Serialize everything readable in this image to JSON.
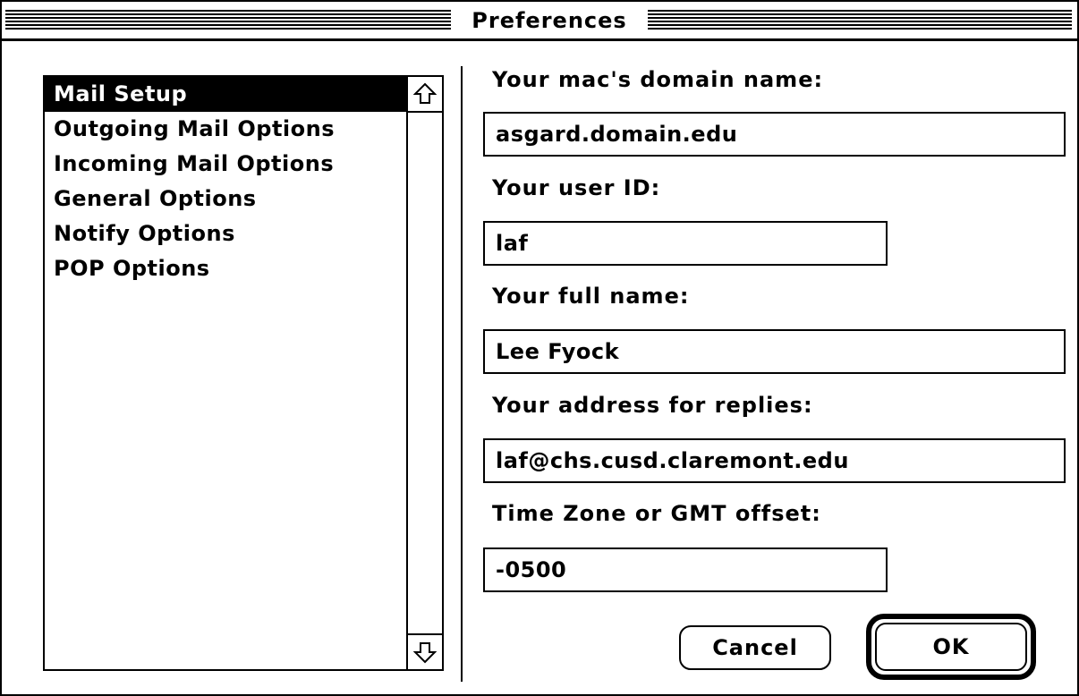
{
  "window": {
    "title": "Preferences"
  },
  "sidebar": {
    "items": [
      {
        "label": "Mail Setup",
        "selected": true
      },
      {
        "label": "Outgoing Mail Options",
        "selected": false
      },
      {
        "label": "Incoming Mail Options",
        "selected": false
      },
      {
        "label": "General Options",
        "selected": false
      },
      {
        "label": "Notify Options",
        "selected": false
      },
      {
        "label": "POP Options",
        "selected": false
      }
    ],
    "scroll_up_icon": "arrow-up-outline-icon",
    "scroll_down_icon": "arrow-down-outline-icon"
  },
  "form": {
    "domain": {
      "label": "Your mac's domain name:",
      "value": "asgard.domain.edu"
    },
    "user_id": {
      "label": "Your user ID:",
      "value": "laf"
    },
    "full_name": {
      "label": "Your full name:",
      "value": "Lee Fyock"
    },
    "reply_address": {
      "label": "Your address for replies:",
      "value": "laf@chs.cusd.claremont.edu"
    },
    "time_zone": {
      "label": "Time Zone or GMT offset:",
      "value": "-0500"
    }
  },
  "buttons": {
    "cancel": "Cancel",
    "ok": "OK"
  },
  "colors": {
    "foreground": "#000000",
    "background": "#ffffff"
  }
}
